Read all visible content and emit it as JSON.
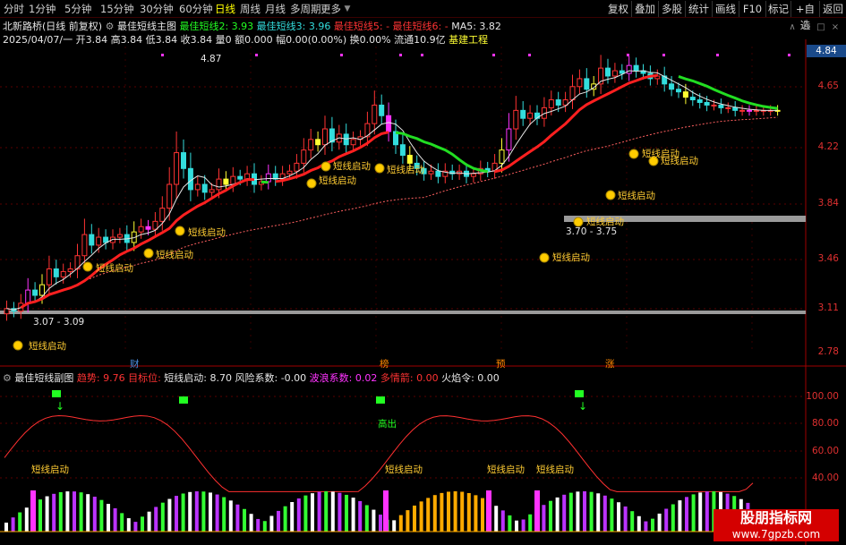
{
  "toolbar": {
    "periods": [
      "分时",
      "1分钟",
      "5分钟",
      "15分钟",
      "30分钟",
      "60分钟",
      "日线",
      "周线",
      "月线",
      "多周期",
      "更多"
    ],
    "active_period": "日线",
    "right_buttons": [
      "复权",
      "叠加",
      "多股",
      "统计",
      "画线",
      "F10",
      "标记",
      "+自选",
      "返回"
    ]
  },
  "header": {
    "stock_name": "北新路桥(日线 前复权)",
    "indicator_name": "最佳短线主图",
    "ind_items": [
      {
        "label": "最佳短线2: 3.93",
        "color": "#22ff22"
      },
      {
        "label": "最佳短线3: 3.96",
        "color": "#33dddd"
      },
      {
        "label": "最佳短线5: -",
        "color": "#ff3333"
      },
      {
        "label": "最佳短线6: -",
        "color": "#ff3333"
      },
      {
        "label": "MA5: 3.82",
        "color": "#e6e6e6"
      }
    ],
    "quote_line": {
      "date": "2025/04/07/一",
      "open": "开3.84",
      "high": "高3.84",
      "low": "低3.84",
      "close": "收3.84",
      "volume": "量0",
      "amount": "额0.000",
      "change": "幅0.00(0.00%)",
      "turnover": "换0.00%",
      "float": "流通10.9亿",
      "sector": "基建工程"
    }
  },
  "price_axis": [
    "4.84",
    "4.65",
    "4.22",
    "3.84",
    "3.46",
    "3.11",
    "2.78"
  ],
  "current_price": "4.84",
  "annotations": {
    "high_label": "4.87",
    "low_label_1": "3.07 - 3.09",
    "low_label_2": "3.70 - 3.75",
    "signal_text": "短线启动",
    "markers": [
      "财",
      "榜",
      "预",
      "涨"
    ]
  },
  "sub_header": {
    "title": "最佳短线副图",
    "items": [
      {
        "label": "趋势: 9.76",
        "color": "#ff3333"
      },
      {
        "label": "目标位:",
        "color": "#ff3333"
      },
      {
        "label": "短线启动: 8.70",
        "color": "#e6e6e6"
      },
      {
        "label": "风险系数: -0.00",
        "color": "#e6e6e6"
      },
      {
        "label": "波浪系数: 0.02",
        "color": "#ff33ff"
      },
      {
        "label": "多情箭: 0.00",
        "color": "#ff3333"
      },
      {
        "label": "火焰令: 0.00",
        "color": "#e6e6e6"
      }
    ]
  },
  "sub_axis": [
    "100.00",
    "80.00",
    "60.00",
    "40.00"
  ],
  "sub_annotations": {
    "exit": "高出",
    "signal": "短线启动"
  },
  "watermark": {
    "line1": "股朋指标网",
    "line2": "www.7gpzb.com"
  },
  "colors": {
    "up": "#ff3333",
    "down": "#33dddd",
    "trend_red": "#ff2020",
    "trend_green": "#22dd22",
    "magenta": "#ff33ff",
    "yellow": "#ffff33"
  }
}
